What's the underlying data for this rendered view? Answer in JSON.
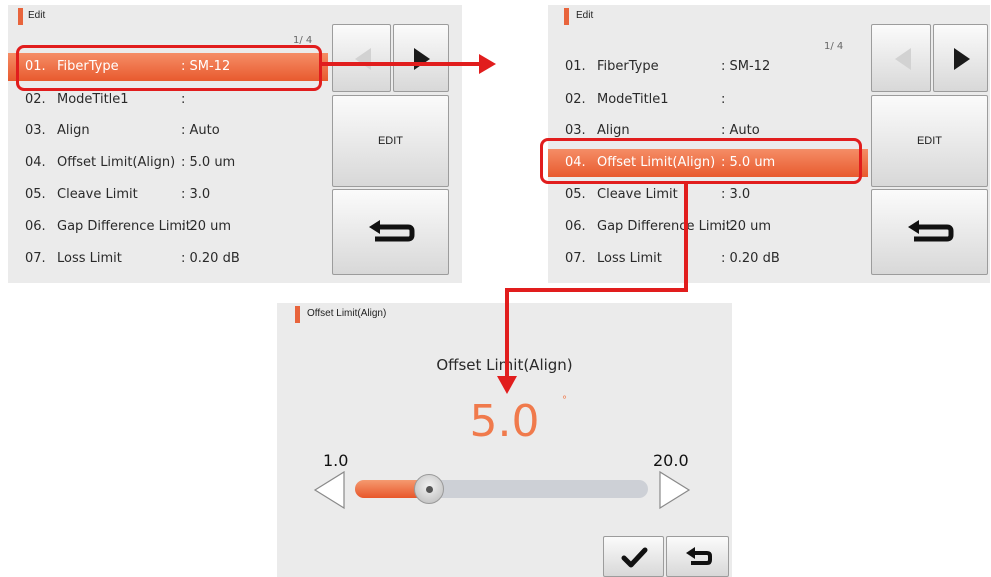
{
  "edit_screen": {
    "title": "Edit",
    "page_indicator": "1/ 4",
    "rows": [
      {
        "num": "01.",
        "label": "FiberType",
        "value": ": SM-12"
      },
      {
        "num": "02.",
        "label": "ModeTitle1",
        "value": ":"
      },
      {
        "num": "03.",
        "label": "Align",
        "value": ": Auto"
      },
      {
        "num": "04.",
        "label": "Offset Limit(Align)",
        "value": ": 5.0 um"
      },
      {
        "num": "05.",
        "label": "Cleave Limit",
        "value": ": 3.0"
      },
      {
        "num": "06.",
        "label": "Gap Difference Limit",
        "value": ": 20 um"
      },
      {
        "num": "07.",
        "label": "Loss Limit",
        "value": ": 0.20 dB"
      }
    ],
    "buttons": {
      "prev_icon": "left-triangle-icon",
      "next_icon": "right-triangle-icon",
      "edit_label": "EDIT",
      "back_icon": "return-arrow-icon"
    }
  },
  "edit_screen_2": {
    "title": "Edit",
    "page_indicator": "1/ 4"
  },
  "value_screen": {
    "title": "Offset Limit(Align)",
    "param_title": "Offset Limit(Align)",
    "current_value": "5.0",
    "unit_mark": "°",
    "min_label": "1.0",
    "max_label": "20.0",
    "slider_fraction": 0.21,
    "ok_icon": "check-icon",
    "cancel_icon": "return-arrow-icon"
  },
  "colors": {
    "accent": "#e8643c",
    "highlight_box": "#e11d1d",
    "panel_bg": "#ebebeb"
  }
}
